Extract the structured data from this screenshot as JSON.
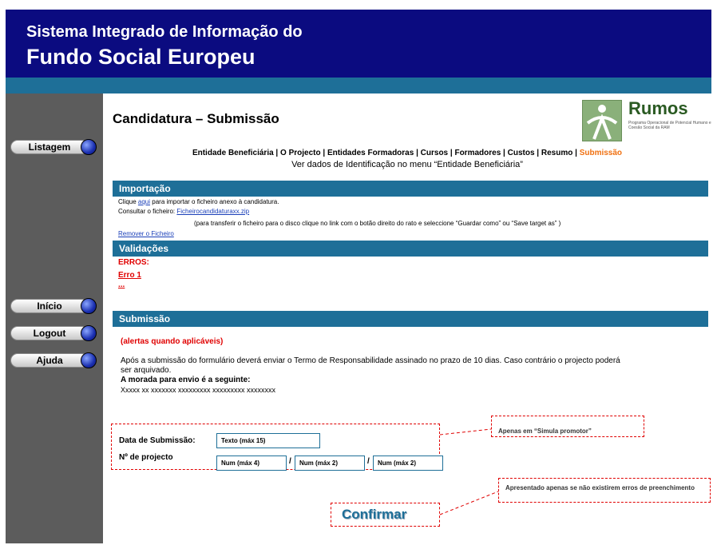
{
  "header": {
    "line1": "Sistema Integrado de Informação do",
    "line2": "Fundo Social Europeu"
  },
  "sidebar": {
    "items": [
      {
        "label": "Listagem"
      },
      {
        "label": "Início"
      },
      {
        "label": "Logout"
      },
      {
        "label": "Ajuda"
      }
    ]
  },
  "page": {
    "title": "Candidatura – Submissão"
  },
  "logo": {
    "word": "Rumos",
    "small": "Programa Operacional de Potencial Humano e Coesão Social da RAM"
  },
  "menu": {
    "items": [
      "Entidade Beneficiária | ",
      "O Projecto | ",
      "Entidades Formadoras | ",
      "Cursos | ",
      "Formadores | ",
      "Custos | ",
      "Resumo | "
    ],
    "active": "Submissão"
  },
  "info_line": "Ver dados de Identificação no menu “Entidade Beneficiária”",
  "importacao": {
    "title": "Importação",
    "line1_pre": "Clique ",
    "line1_link": "aqui",
    "line1_post": " para importar o ficheiro anexo à candidatura.",
    "line2_pre": "Consultar o ficheiro: ",
    "line2_link": "Ficheirocandidaturaxx.zip",
    "hint": "(para transferir o ficheiro para o disco clique no link com o botão direito do rato e seleccione “Guardar como” ou “Save target as” )",
    "remove": "Remover o Ficheiro"
  },
  "validacoes": {
    "title": "Validações",
    "erros": "ERROS:",
    "erro1": "Erro 1",
    "more": "..."
  },
  "submissao": {
    "title": "Submissão",
    "alert": "(alertas quando aplicáveis)",
    "text1": "Após a submissão do formulário deverá enviar o Termo de Responsabilidade assinado no prazo de 10 dias. Caso contrário o projecto poderá",
    "text2": "ser arquivado.",
    "address_label": "A morada para envio é a seguinte:",
    "address": "Xxxxx xx xxxxxxx xxxxxxxxx xxxxxxxxx xxxxxxxx"
  },
  "form": {
    "date_label": "Data de Submissão:",
    "date_value": "Texto (máx 15)",
    "project_label": "Nº de projecto",
    "num1": "Num (máx 4)",
    "num2": "Num (máx 2)",
    "num3": "Num (máx 2)",
    "sep": "/"
  },
  "notes": {
    "simula": "Apenas em “Simula promotor”",
    "erros": "Apresentado apenas se não existirem erros de preenchimento"
  },
  "confirm_label": "Confirmar"
}
